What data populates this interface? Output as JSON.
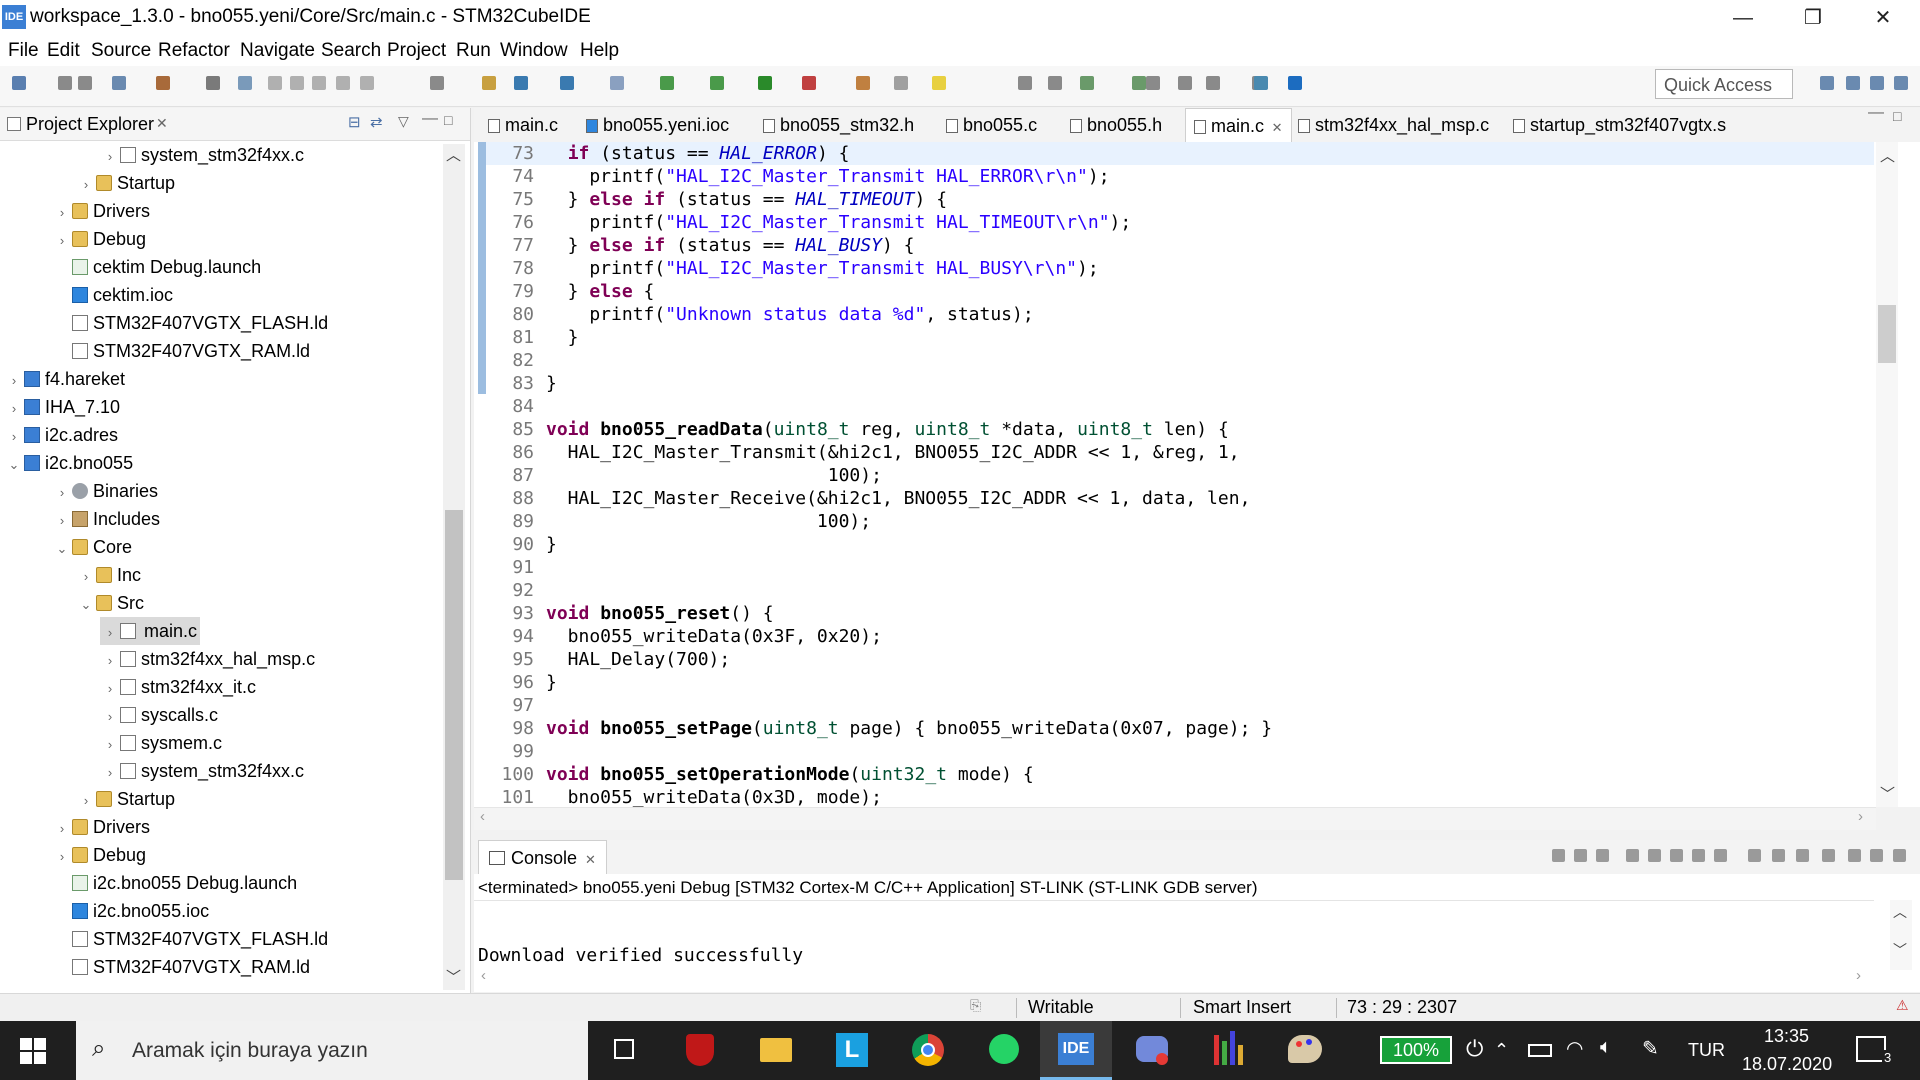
{
  "window": {
    "title": "workspace_1.3.0 - bno055.yeni/Core/Src/main.c - STM32CubeIDE",
    "app_icon": "IDE",
    "minimize": "—",
    "maximize": "❐",
    "close": "✕"
  },
  "menu": [
    "File",
    "Edit",
    "Source",
    "Refactor",
    "Navigate",
    "Search",
    "Project",
    "Run",
    "Window",
    "Help"
  ],
  "toolbar": {
    "quick_access_placeholder": "Quick Access"
  },
  "explorer": {
    "title": "Project Explorer",
    "rows": [
      {
        "label": "system_stm32f4xx.c",
        "twisty": "›",
        "icon": "file"
      },
      {
        "label": "Startup",
        "twisty": "›",
        "icon": "folder"
      },
      {
        "label": "Drivers",
        "twisty": "›",
        "icon": "folder"
      },
      {
        "label": "Debug",
        "twisty": "›",
        "icon": "folder"
      },
      {
        "label": "cektim Debug.launch",
        "twisty": "",
        "icon": "launch"
      },
      {
        "label": "cektim.ioc",
        "twisty": "",
        "icon": "mx"
      },
      {
        "label": "STM32F407VGTX_FLASH.ld",
        "twisty": "",
        "icon": "file"
      },
      {
        "label": "STM32F407VGTX_RAM.ld",
        "twisty": "",
        "icon": "file"
      },
      {
        "label": "f4.hareket",
        "twisty": "›",
        "icon": "ide"
      },
      {
        "label": "IHA_7.10",
        "twisty": "›",
        "icon": "ide"
      },
      {
        "label": "i2c.adres",
        "twisty": "›",
        "icon": "ide"
      },
      {
        "label": "i2c.bno055",
        "twisty": "⌄",
        "icon": "ide"
      },
      {
        "label": "Binaries",
        "twisty": "›",
        "icon": "bin"
      },
      {
        "label": "Includes",
        "twisty": "›",
        "icon": "inc"
      },
      {
        "label": "Core",
        "twisty": "⌄",
        "icon": "folder"
      },
      {
        "label": "Inc",
        "twisty": "›",
        "icon": "folder"
      },
      {
        "label": "Src",
        "twisty": "⌄",
        "icon": "folder"
      },
      {
        "label": "main.c",
        "twisty": "›",
        "icon": "file",
        "selected": true
      },
      {
        "label": "stm32f4xx_hal_msp.c",
        "twisty": "›",
        "icon": "file"
      },
      {
        "label": "stm32f4xx_it.c",
        "twisty": "›",
        "icon": "file"
      },
      {
        "label": "syscalls.c",
        "twisty": "›",
        "icon": "file"
      },
      {
        "label": "sysmem.c",
        "twisty": "›",
        "icon": "file"
      },
      {
        "label": "system_stm32f4xx.c",
        "twisty": "›",
        "icon": "file"
      },
      {
        "label": "Startup",
        "twisty": "›",
        "icon": "folder"
      },
      {
        "label": "Drivers",
        "twisty": "›",
        "icon": "folder"
      },
      {
        "label": "Debug",
        "twisty": "›",
        "icon": "folder"
      },
      {
        "label": "i2c.bno055 Debug.launch",
        "twisty": "",
        "icon": "launch"
      },
      {
        "label": "i2c.bno055.ioc",
        "twisty": "",
        "icon": "mx"
      },
      {
        "label": "STM32F407VGTX_FLASH.ld",
        "twisty": "",
        "icon": "file"
      },
      {
        "label": "STM32F407VGTX_RAM.ld",
        "twisty": "",
        "icon": "file"
      }
    ]
  },
  "editor_tabs": [
    {
      "label": "main.c",
      "active": false
    },
    {
      "label": "bno055.yeni.ioc",
      "active": false
    },
    {
      "label": "bno055_stm32.h",
      "active": false
    },
    {
      "label": "bno055.c",
      "active": false
    },
    {
      "label": "bno055.h",
      "active": false
    },
    {
      "label": "main.c",
      "active": true
    },
    {
      "label": "stm32f4xx_hal_msp.c",
      "active": false
    },
    {
      "label": "startup_stm32f407vgtx.s",
      "active": false
    }
  ],
  "code": [
    {
      "n": "73",
      "t": "  if (status == HAL_ERROR) {"
    },
    {
      "n": "74",
      "t": "    printf(\"HAL_I2C_Master_Transmit HAL_ERROR\\r\\n\");"
    },
    {
      "n": "75",
      "t": "  } else if (status == HAL_TIMEOUT) {"
    },
    {
      "n": "76",
      "t": "    printf(\"HAL_I2C_Master_Transmit HAL_TIMEOUT\\r\\n\");"
    },
    {
      "n": "77",
      "t": "  } else if (status == HAL_BUSY) {"
    },
    {
      "n": "78",
      "t": "    printf(\"HAL_I2C_Master_Transmit HAL_BUSY\\r\\n\");"
    },
    {
      "n": "79",
      "t": "  } else {"
    },
    {
      "n": "80",
      "t": "    printf(\"Unknown status data %d\", status);"
    },
    {
      "n": "81",
      "t": "  }"
    },
    {
      "n": "82",
      "t": ""
    },
    {
      "n": "83",
      "t": "}"
    },
    {
      "n": "84",
      "t": ""
    },
    {
      "n": "85",
      "t": "void bno055_readData(uint8_t reg, uint8_t *data, uint8_t len) {"
    },
    {
      "n": "86",
      "t": "  HAL_I2C_Master_Transmit(&hi2c1, BNO055_I2C_ADDR << 1, &reg, 1,"
    },
    {
      "n": "87",
      "t": "                          100);"
    },
    {
      "n": "88",
      "t": "  HAL_I2C_Master_Receive(&hi2c1, BNO055_I2C_ADDR << 1, data, len,"
    },
    {
      "n": "89",
      "t": "                         100);"
    },
    {
      "n": "90",
      "t": "}"
    },
    {
      "n": "91",
      "t": ""
    },
    {
      "n": "92",
      "t": ""
    },
    {
      "n": "93",
      "t": "void bno055_reset() {"
    },
    {
      "n": "94",
      "t": "  bno055_writeData(0x3F, 0x20);"
    },
    {
      "n": "95",
      "t": "  HAL_Delay(700);"
    },
    {
      "n": "96",
      "t": "}"
    },
    {
      "n": "97",
      "t": ""
    },
    {
      "n": "98",
      "t": "void bno055_setPage(uint8_t page) { bno055_writeData(0x07, page); }"
    },
    {
      "n": "99",
      "t": ""
    },
    {
      "n": "100",
      "t": "void bno055_setOperationMode(uint32_t mode) {"
    },
    {
      "n": "101",
      "t": "  bno055_writeData(0x3D, mode);"
    }
  ],
  "console": {
    "title": "Console",
    "status": "<terminated> bno055.yeni Debug [STM32 Cortex-M C/C++ Application] ST-LINK (ST-LINK GDB server)",
    "output": "Download verified successfully"
  },
  "statusbar": {
    "writable": "Writable",
    "insert_mode": "Smart Insert",
    "position": "73 : 29 : 2307"
  },
  "taskbar": {
    "search_placeholder": "Aramak için buraya yazın",
    "battery": "100%",
    "language": "TUR",
    "time": "13:35",
    "date": "18.07.2020",
    "notification_count": "3",
    "ide_label": "IDE"
  },
  "colors": {
    "accent": "#3b7fd4",
    "keyword": "#7f0055",
    "string": "#2a00ff",
    "macro": "#0000c0"
  }
}
